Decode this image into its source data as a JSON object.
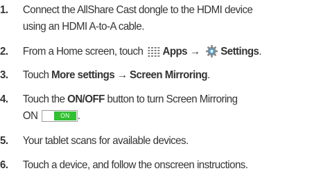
{
  "steps": [
    {
      "number": "1.",
      "line1": "Connect the AllShare Cast dongle to the HDMI device",
      "line2": "using an HDMI A-to-A cable."
    },
    {
      "number": "2.",
      "prefix": "From a Home screen, touch ",
      "apps_label": "Apps",
      "arrow": " → ",
      "settings_label": "Settings",
      "suffix": "."
    },
    {
      "number": "3.",
      "prefix": "Touch ",
      "bold": "More settings → Screen Mirroring",
      "suffix": "."
    },
    {
      "number": "4.",
      "prefix": "Touch the ",
      "bold": "ON/OFF",
      "line1_suffix": " button to turn Screen Mirroring",
      "line2_prefix": "ON",
      "toggle_label": "ON",
      "line2_suffix": "."
    },
    {
      "number": "5.",
      "text": "Your tablet scans for available devices."
    },
    {
      "number": "6.",
      "text": "Touch a device, and follow the onscreen instructions."
    }
  ],
  "icons": {
    "apps": "apps-grid-icon",
    "settings": "settings-gear-icon"
  },
  "colors": {
    "text": "#333333",
    "toggle_on": "#30c030"
  }
}
